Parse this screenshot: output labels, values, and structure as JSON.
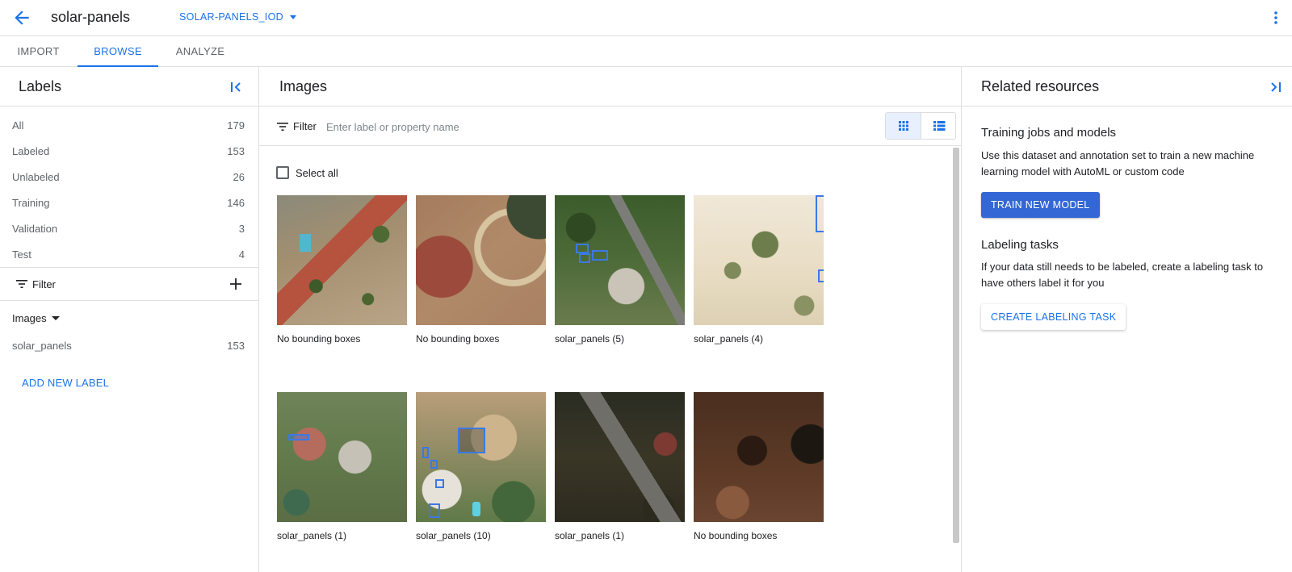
{
  "header": {
    "title": "solar-panels",
    "dataset_selector": "SOLAR-PANELS_IOD"
  },
  "tabs": [
    {
      "label": "IMPORT"
    },
    {
      "label": "BROWSE"
    },
    {
      "label": "ANALYZE"
    }
  ],
  "labels_panel": {
    "title": "Labels",
    "items": [
      {
        "name": "All",
        "count": "179"
      },
      {
        "name": "Labeled",
        "count": "153"
      },
      {
        "name": "Unlabeled",
        "count": "26"
      },
      {
        "name": "Training",
        "count": "146"
      },
      {
        "name": "Validation",
        "count": "3"
      },
      {
        "name": "Test",
        "count": "4"
      }
    ],
    "filter_label": "Filter",
    "group": {
      "name": "Images",
      "items": [
        {
          "name": "solar_panels",
          "count": "153"
        }
      ]
    },
    "add_new_label": "ADD NEW LABEL"
  },
  "images_panel": {
    "title": "Images",
    "filter_label": "Filter",
    "filter_placeholder": "Enter label or property name",
    "select_all": "Select all",
    "images": [
      {
        "caption": "No bounding boxes"
      },
      {
        "caption": "No bounding boxes"
      },
      {
        "caption": "solar_panels (5)"
      },
      {
        "caption": "solar_panels (4)"
      },
      {
        "caption": "solar_panels (1)"
      },
      {
        "caption": "solar_panels (10)"
      },
      {
        "caption": "solar_panels (1)"
      },
      {
        "caption": "No bounding boxes"
      }
    ]
  },
  "related_panel": {
    "title": "Related resources",
    "training": {
      "title": "Training jobs and models",
      "description": "Use this dataset and annotation set to train a new machine learning model with AutoML or custom code",
      "button": "TRAIN NEW MODEL"
    },
    "labeling": {
      "title": "Labeling tasks",
      "description": "If your data still needs to be labeled, create a labeling task to have others label it for you",
      "button": "CREATE LABELING TASK"
    }
  },
  "colors": {
    "accent": "#1a73e8",
    "primary_button": "#3367d6",
    "bbox": "#3b78e7"
  }
}
